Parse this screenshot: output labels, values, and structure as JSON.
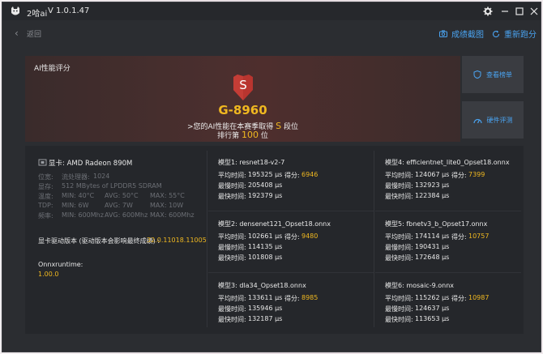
{
  "titlebar": {
    "app_name": "2哈ai",
    "version": "V 1.0.1.47",
    "settings_icon": "gear-icon",
    "minimize_icon": "minimize-icon",
    "maximize_icon": "maximize-icon",
    "close_icon": "close-icon"
  },
  "nav": {
    "back_label": "返回",
    "screenshot_label": "成绩截图",
    "rescore_label": "重新跑分"
  },
  "hero": {
    "title": "AI性能评分",
    "badge_letter": "S",
    "score": "G-8960",
    "line1_prefix": ">您的AI性能在本赛季取得 ",
    "line1_grade": "S",
    "line1_suffix": " 段位",
    "line2_prefix": "排行第 ",
    "line2_rank": "100",
    "line2_suffix": " 位",
    "leaderboard_label": "查看榜单",
    "hardware_label": "硬件评测"
  },
  "gpu": {
    "name": "显卡: AMD Radeon 890M",
    "specs": [
      {
        "label": "位宽:",
        "value": "流处理器:",
        "extra": "1024"
      },
      {
        "label": "显存:",
        "value": "512 MBytes of LPDDR5 SDRAM"
      }
    ],
    "stats": [
      {
        "label": "温度:",
        "min": "MIN: 40°C",
        "avg": "AVG: 50°C",
        "max": "MAX: 55°C"
      },
      {
        "label": "TDP:",
        "min": "MIN: 6W",
        "avg": "AVG: 7W",
        "max": "MAX: 10W"
      },
      {
        "label": "频率:",
        "min": "MIN: 600Mhz",
        "avg": "AVG: 600Mhz",
        "max": "MAX: 600Mhz"
      }
    ],
    "driver_label": "显卡驱动版本 (驱动版本会影响最终成绩) :",
    "driver_value": "32.0.11018.11005",
    "onnx_label": "Onnxruntime:",
    "onnx_value": "1.00.0"
  },
  "labels": {
    "avg": "平均时间:",
    "slow": "最慢时间:",
    "fast": "最快时间:",
    "score": "得分:"
  },
  "models": [
    {
      "title": "模型1:  resnet18-v2-7",
      "avg": "195325 μs",
      "slow": "205408 μs",
      "fast": "192379 μs",
      "score": "6946"
    },
    {
      "title": "模型2:  densenet121_Opset18.onnx",
      "avg": "102661 μs",
      "slow": "114135 μs",
      "fast": "101808 μs",
      "score": "9480"
    },
    {
      "title": "模型3:  dla34_Opset18.onnx",
      "avg": "133611 μs",
      "slow": "135946 μs",
      "fast": "132187 μs",
      "score": "8985"
    },
    {
      "title": "模型4:  efficientnet_lite0_Opset18.onnx",
      "avg": "124067 μs",
      "slow": "132923 μs",
      "fast": "122384 μs",
      "score": "7399"
    },
    {
      "title": "模型5:  fbnetv3_b_Opset17.onnx",
      "avg": "174114 μs",
      "slow": "190431 μs",
      "fast": "172648 μs",
      "score": "10757"
    },
    {
      "title": "模型6:  mosaic-9.onnx",
      "avg": "115262 μs",
      "slow": "124637 μs",
      "fast": "113653 μs",
      "score": "10987"
    }
  ],
  "colors": {
    "accent": "#4aa3f0",
    "highlight": "#f0b820",
    "badge": "#b8352f"
  }
}
